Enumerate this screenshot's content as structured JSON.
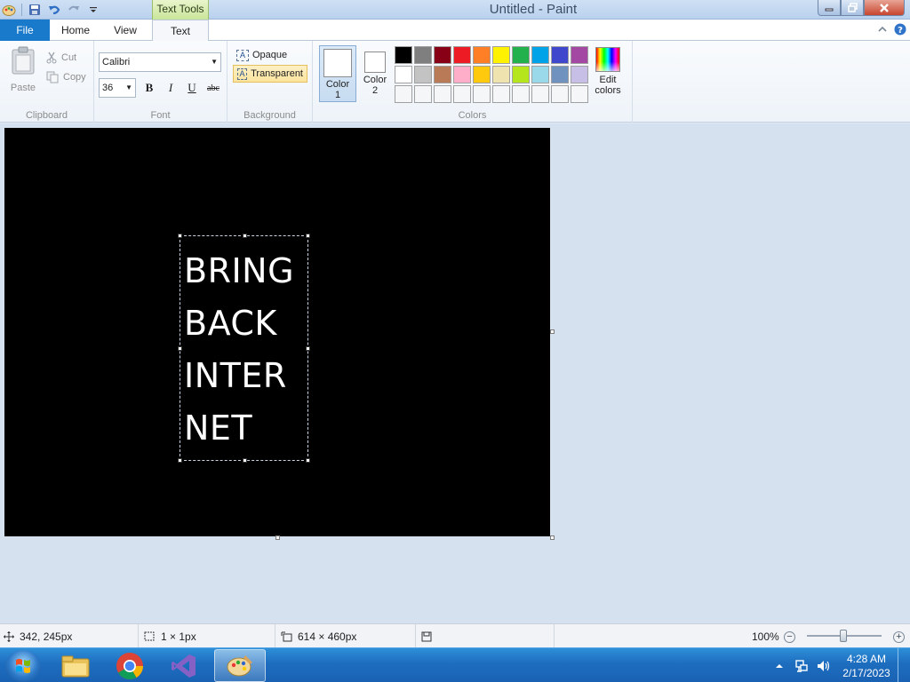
{
  "window": {
    "title": "Untitled - Paint",
    "context_tab_group": "Text Tools"
  },
  "tabs": {
    "file": "File",
    "home": "Home",
    "view": "View",
    "text": "Text"
  },
  "clipboard": {
    "paste": "Paste",
    "cut": "Cut",
    "copy": "Copy",
    "group_label": "Clipboard"
  },
  "font": {
    "family": "Calibri",
    "size": "36",
    "group_label": "Font",
    "bold": "B",
    "italic": "I",
    "underline": "U",
    "strikethrough": "abc"
  },
  "background": {
    "opaque": "Opaque",
    "transparent": "Transparent",
    "group_label": "Background"
  },
  "colors": {
    "color1_label": "Color 1",
    "color2_label": "Color 2",
    "edit_colors": "Edit colors",
    "group_label": "Colors",
    "color1": "#ffffff",
    "color2": "#ffffff",
    "palette_row1": [
      "#000000",
      "#7f7f7f",
      "#880015",
      "#ed1c24",
      "#ff7f27",
      "#fff200",
      "#22b14c",
      "#00a2e8",
      "#3f48cc",
      "#a349a4"
    ],
    "palette_row2": [
      "#ffffff",
      "#c3c3c3",
      "#b97a57",
      "#ffaec9",
      "#ffc90e",
      "#efe4b0",
      "#b5e61d",
      "#99d9ea",
      "#7092be",
      "#c8bfe7"
    ],
    "palette_row3": [
      "#f5f6f7",
      "#f5f6f7",
      "#f5f6f7",
      "#f5f6f7",
      "#f5f6f7",
      "#f5f6f7",
      "#f5f6f7",
      "#f5f6f7",
      "#f5f6f7",
      "#f5f6f7"
    ]
  },
  "canvas": {
    "background": "#000000",
    "text_lines": [
      "BRING",
      "BACK",
      "INTER",
      "NET"
    ]
  },
  "status": {
    "cursor_pos": "342, 245px",
    "selection_size": "1 × 1px",
    "image_size": "614 × 460px",
    "zoom": "100%",
    "zoom_minus": "−",
    "zoom_plus": "+"
  },
  "taskbar": {
    "time": "4:28 AM",
    "date": "2/17/2023",
    "apps": [
      "file-explorer",
      "google-chrome",
      "visual-studio",
      "paint"
    ]
  }
}
